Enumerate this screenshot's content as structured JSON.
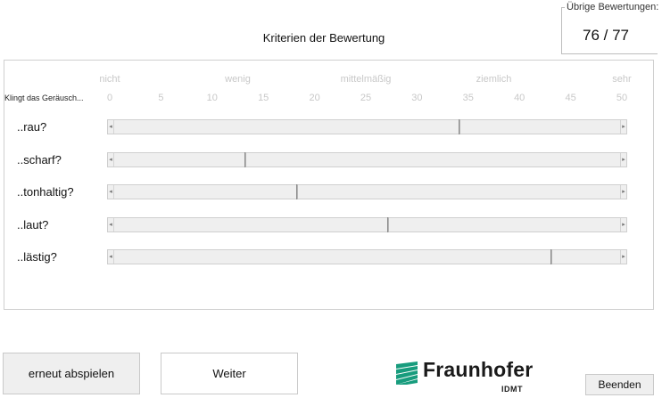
{
  "header": {
    "title": "Kriterien der Bewertung",
    "remaining_label": "Übrige Bewertungen:",
    "remaining_value": "76 / 77"
  },
  "scale": {
    "question": "Klingt das Geräusch...",
    "words": [
      "nicht",
      "wenig",
      "mittelmäßig",
      "ziemlich",
      "sehr"
    ],
    "ticks": [
      "0",
      "5",
      "10",
      "15",
      "20",
      "25",
      "30",
      "35",
      "40",
      "45",
      "50"
    ],
    "min": 0,
    "max": 50
  },
  "criteria": [
    {
      "label": "..rau?",
      "value": 34
    },
    {
      "label": "..scharf?",
      "value": 13
    },
    {
      "label": "..tonhaltig?",
      "value": 18
    },
    {
      "label": "..laut?",
      "value": 27
    },
    {
      "label": "..lästig?",
      "value": 43
    }
  ],
  "buttons": {
    "replay": "erneut abspielen",
    "next": "Weiter",
    "quit": "Beenden"
  },
  "logo": {
    "name": "Fraunhofer",
    "sub": "IDMT",
    "color": "#179c7d"
  },
  "arrows": {
    "left": "◂",
    "right": "▸"
  }
}
